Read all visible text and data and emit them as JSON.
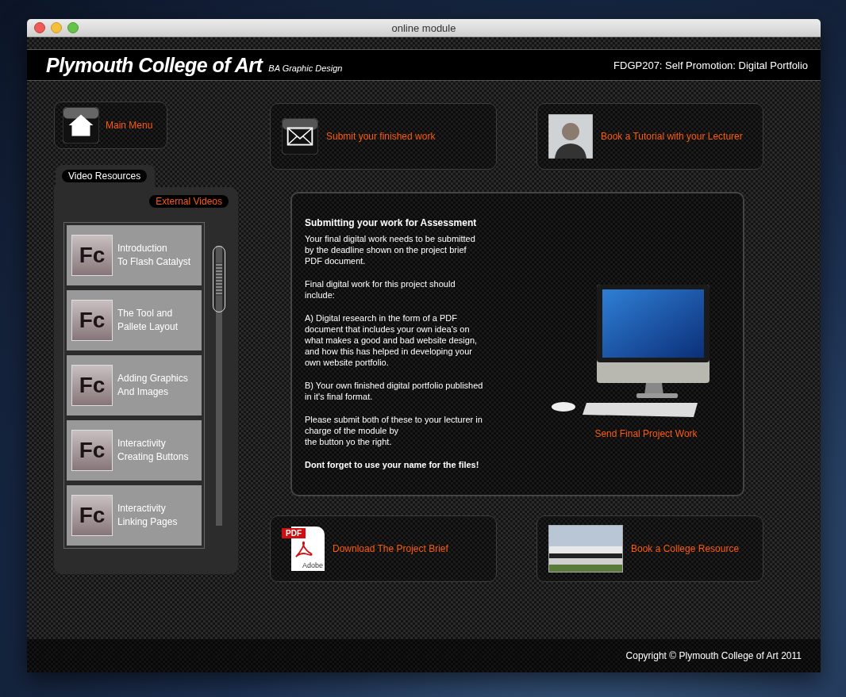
{
  "window": {
    "title": "online module"
  },
  "header": {
    "title": "Plymouth College of Art",
    "subtitle": "BA Graphic Design",
    "module": "FDGP207: Self Promotion: Digital Portfolio"
  },
  "main_menu": {
    "label": "Main Menu"
  },
  "top_links": [
    {
      "kind": "mail",
      "label": "Submit your finished work"
    },
    {
      "kind": "person",
      "label": "Book a Tutorial with your Lecturer"
    }
  ],
  "video_panel": {
    "tab": "Video Resources",
    "external": "External Videos",
    "videos": [
      {
        "icon_label": "Fc",
        "title": "Introduction\nTo Flash Catalyst"
      },
      {
        "icon_label": "Fc",
        "title": "The Tool and\nPallete Layout"
      },
      {
        "icon_label": "Fc",
        "title": "Adding Graphics\nAnd Images"
      },
      {
        "icon_label": "Fc",
        "title": "Interactivity\nCreating Buttons"
      },
      {
        "icon_label": "Fc",
        "title": "Interactivity\nLinking Pages"
      }
    ]
  },
  "assessment": {
    "heading": "Submitting your work for Assessment",
    "paragraphs": [
      {
        "kind": "plain",
        "text": "Your final digital work needs to be submitted\nby the deadline shown on the project brief\nPDF document."
      },
      {
        "kind": "plain",
        "text": "Final digital work for this project should\ninclude:"
      },
      {
        "kind": "plain",
        "text": "A) Digital research in the form of a PDF\ndocument that includes your own idea's on\nwhat makes a good and bad website design,\nand how this has helped in developing your\nown website portfolio."
      },
      {
        "kind": "plain",
        "text": "B) Your own finished digital portfolio published\nin it's final format."
      },
      {
        "kind": "plain",
        "text": "Please submit both of these to your lecturer in\ncharge of the module by\nthe button yo the right."
      },
      {
        "kind": "bold",
        "text": "Dont forget to use your name for the files!"
      }
    ],
    "send_link": "Send Final Project Work"
  },
  "bottom_links": [
    {
      "kind": "pdf",
      "label": "Download The Project Brief",
      "icon_texts": [
        "PDF",
        "Adobe"
      ]
    },
    {
      "kind": "building",
      "label": "Book a College Resource"
    }
  ],
  "footer": {
    "copyright": "Copyright © Plymouth College of Art 2011"
  }
}
